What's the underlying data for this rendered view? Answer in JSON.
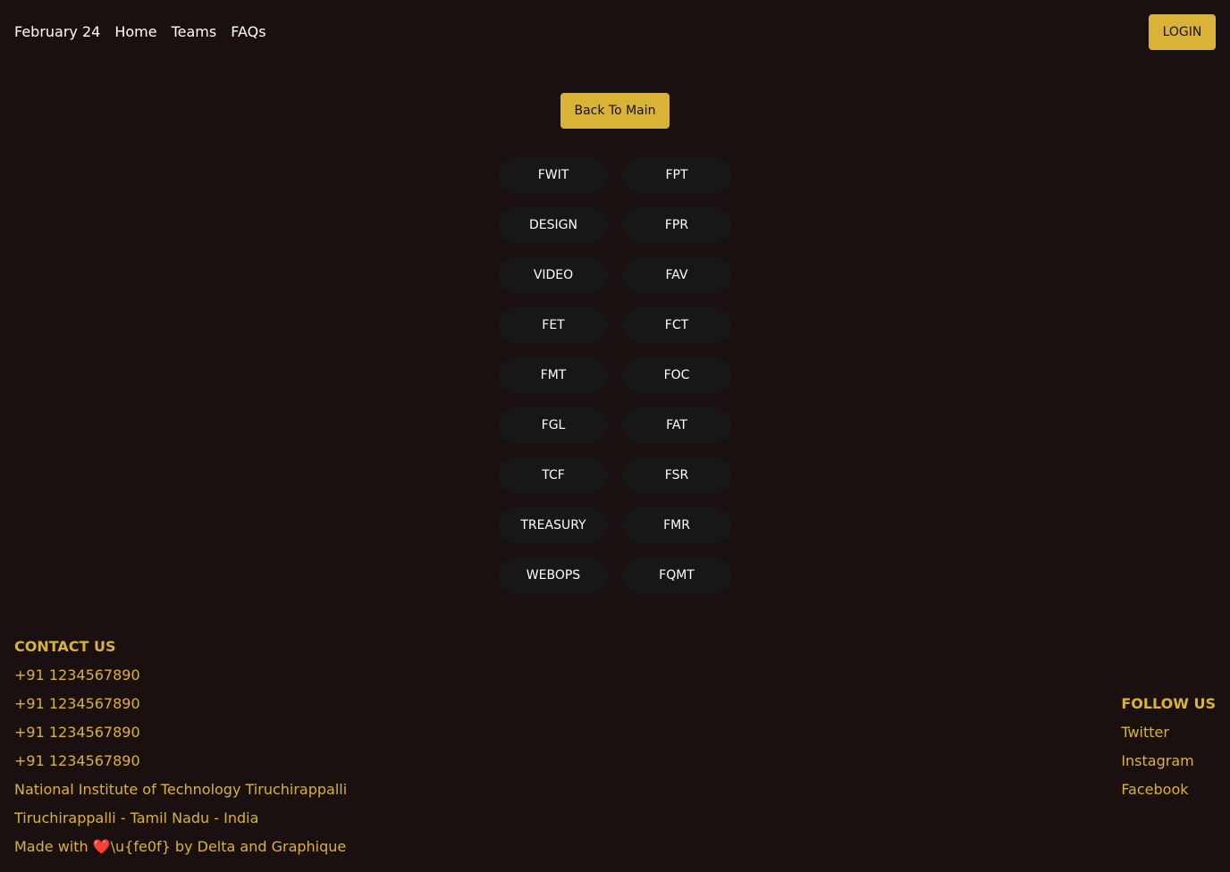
{
  "nav": {
    "brand": "February 24",
    "links": [
      {
        "label": "Home"
      },
      {
        "label": "Teams"
      },
      {
        "label": "FAQs"
      }
    ],
    "login_label": "LOGIN"
  },
  "back_label": "Back To Main",
  "teams": [
    "FWIT",
    "FPT",
    "DESIGN",
    "FPR",
    "VIDEO",
    "FAV",
    "FET",
    "FCT",
    "FMT",
    "FOC",
    "FGL",
    "FAT",
    "TCF",
    "FSR",
    "TREASURY",
    "FMR",
    "WEBOPS",
    "FQMT"
  ],
  "contact": {
    "heading": "CONTACT US",
    "phones": [
      "+91 1234567890",
      "+91 1234567890",
      "+91 1234567890",
      "+91 1234567890"
    ],
    "institute": "National Institute of Technology Tiruchirappalli",
    "location": "Tiruchirappalli - Tamil Nadu - India",
    "credits": "Made with ❤️\\u{fe0f} by Delta and Graphique"
  },
  "follow": {
    "heading": "FOLLOW US",
    "links": [
      {
        "label": "Twitter"
      },
      {
        "label": "Instagram"
      },
      {
        "label": "Facebook"
      }
    ]
  },
  "colors": {
    "background": "#1a1010",
    "accent": "#d8b338",
    "team_button_bg": "#171618",
    "text": "#ffffff"
  }
}
